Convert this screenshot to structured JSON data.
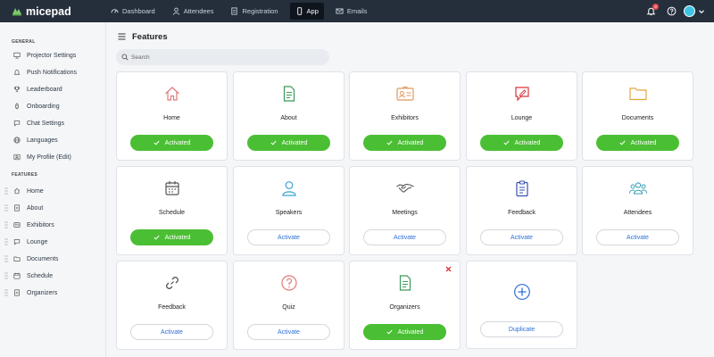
{
  "brand": {
    "name": "micepad"
  },
  "nav": [
    {
      "label": "Dashboard",
      "icon": "dashboard-icon"
    },
    {
      "label": "Attendees",
      "icon": "user-icon"
    },
    {
      "label": "Registration",
      "icon": "document-icon"
    },
    {
      "label": "App",
      "icon": "mobile-icon",
      "active": true
    },
    {
      "label": "Emails",
      "icon": "mail-icon"
    }
  ],
  "notifications": {
    "count": "3"
  },
  "sidebar": {
    "general_label": "GENERAL",
    "general_items": [
      {
        "label": "Projector Settings",
        "icon": "projector-icon"
      },
      {
        "label": "Push Notifications",
        "icon": "bell-icon"
      },
      {
        "label": "Leaderboard",
        "icon": "trophy-icon"
      },
      {
        "label": "Onboarding",
        "icon": "rocket-icon"
      },
      {
        "label": "Chat Settings",
        "icon": "chat-icon"
      },
      {
        "label": "Languages",
        "icon": "globe-icon"
      },
      {
        "label": "My Profile (Edit)",
        "icon": "profile-icon"
      }
    ],
    "features_label": "FEATURES",
    "feature_items": [
      {
        "label": "Home",
        "icon": "home-icon"
      },
      {
        "label": "About",
        "icon": "document-icon"
      },
      {
        "label": "Exhibitors",
        "icon": "id-card-icon"
      },
      {
        "label": "Lounge",
        "icon": "chat-icon"
      },
      {
        "label": "Documents",
        "icon": "folder-icon"
      },
      {
        "label": "Schedule",
        "icon": "calendar-icon"
      },
      {
        "label": "Organizers",
        "icon": "document-icon"
      }
    ]
  },
  "main": {
    "title": "Features",
    "search_placeholder": "Search"
  },
  "cards": [
    {
      "name": "Home",
      "icon": "home-icon",
      "button": "Activated",
      "state": "activated"
    },
    {
      "name": "About",
      "icon": "document-icon",
      "button": "Activated",
      "state": "activated"
    },
    {
      "name": "Exhibitors",
      "icon": "id-card-icon",
      "button": "Activated",
      "state": "activated"
    },
    {
      "name": "Lounge",
      "icon": "chat-icon",
      "button": "Activated",
      "state": "activated"
    },
    {
      "name": "Documents",
      "icon": "folder-icon",
      "button": "Activated",
      "state": "activated"
    },
    {
      "name": "Schedule",
      "icon": "calendar-icon",
      "button": "Activated",
      "state": "activated"
    },
    {
      "name": "Speakers",
      "icon": "user-icon",
      "button": "Activate",
      "state": "inactive"
    },
    {
      "name": "Meetings",
      "icon": "handshake-icon",
      "button": "Activate",
      "state": "inactive"
    },
    {
      "name": "Feedback",
      "icon": "clipboard-icon",
      "button": "Activate",
      "state": "inactive"
    },
    {
      "name": "Attendees",
      "icon": "group-icon",
      "button": "Activate",
      "state": "inactive"
    },
    {
      "name": "Feedback",
      "icon": "link-icon",
      "button": "Activate",
      "state": "inactive"
    },
    {
      "name": "Quiz",
      "icon": "question-icon",
      "button": "Activate",
      "state": "inactive"
    },
    {
      "name": "Organizers",
      "icon": "document-icon",
      "button": "Activated",
      "state": "activated",
      "removable": true
    },
    {
      "name": "",
      "icon": "plus-circle-icon",
      "button": "Duplicate",
      "state": "inactive"
    }
  ],
  "colors": {
    "topbar": "#252f3c",
    "activated": "#4bbf34",
    "link": "#2d6fd6",
    "remove": "#d9363e"
  }
}
